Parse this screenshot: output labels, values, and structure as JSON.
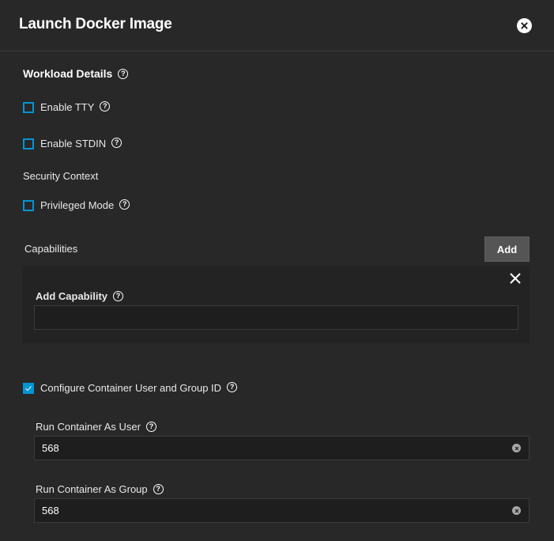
{
  "header": {
    "title": "Launch Docker Image",
    "close_icon": "close-circle-icon"
  },
  "workload": {
    "section_title": "Workload Details",
    "help_icon": "help-circle-icon",
    "enable_tty": {
      "label": "Enable TTY",
      "checked": false
    },
    "enable_stdin": {
      "label": "Enable STDIN",
      "checked": false
    },
    "security_context_label": "Security Context",
    "privileged_mode": {
      "label": "Privileged Mode",
      "checked": false
    }
  },
  "capabilities": {
    "label": "Capabilities",
    "add_button": "Add",
    "items": [
      {
        "label": "Add Capability",
        "value": "",
        "remove_icon": "close-icon"
      }
    ]
  },
  "user_group": {
    "configure": {
      "label": "Configure Container User and Group ID",
      "checked": true
    },
    "run_as_user": {
      "label": "Run Container As User",
      "value": "568"
    },
    "run_as_group": {
      "label": "Run Container As Group",
      "value": "568"
    },
    "clear_icon": "clear-circle-icon"
  },
  "colors": {
    "background": "#282828",
    "accent": "#0095d5",
    "button": "#555555",
    "input_bg": "#1e1e1e"
  }
}
